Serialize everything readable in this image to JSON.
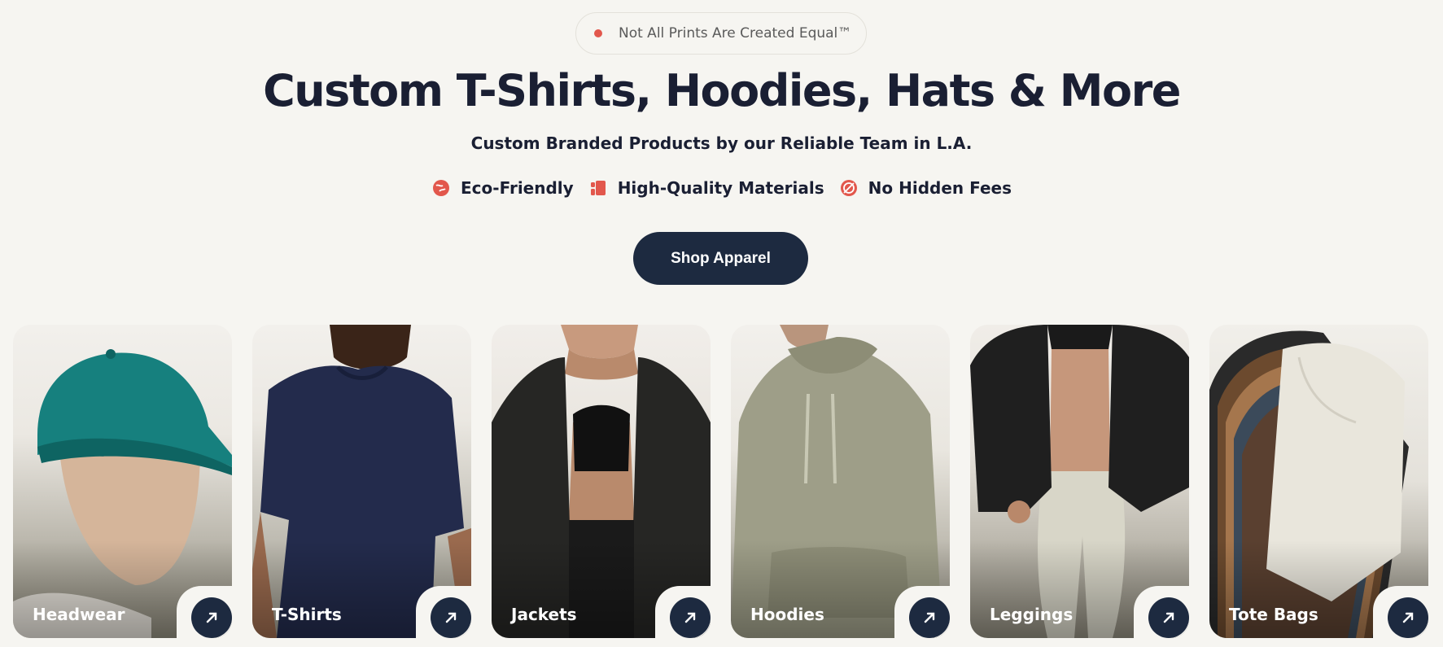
{
  "badge": {
    "text": "Not All Prints Are Created Equal™",
    "dot_color": "#e2574c"
  },
  "hero": {
    "title": "Custom T-Shirts, Hoodies, Hats & More",
    "subtitle": "Custom Branded Products by our Reliable Team in L.A."
  },
  "features": [
    {
      "label": "Eco-Friendly",
      "icon": "leaf-globe-icon"
    },
    {
      "label": "High-Quality Materials",
      "icon": "fabric-roll-icon"
    },
    {
      "label": "No Hidden Fees",
      "icon": "no-dollar-icon"
    }
  ],
  "cta": {
    "label": "Shop Apparel"
  },
  "categories": [
    {
      "label": "Headwear",
      "icon": "arrow-up-right-icon"
    },
    {
      "label": "T-Shirts",
      "icon": "arrow-up-right-icon"
    },
    {
      "label": "Jackets",
      "icon": "arrow-up-right-icon"
    },
    {
      "label": "Hoodies",
      "icon": "arrow-up-right-icon"
    },
    {
      "label": "Leggings",
      "icon": "arrow-up-right-icon"
    },
    {
      "label": "Tote Bags",
      "icon": "arrow-up-right-icon"
    }
  ],
  "colors": {
    "accent": "#e2574c",
    "dark": "#1d2a40",
    "background": "#f6f5f1",
    "text": "#1a1f33"
  }
}
